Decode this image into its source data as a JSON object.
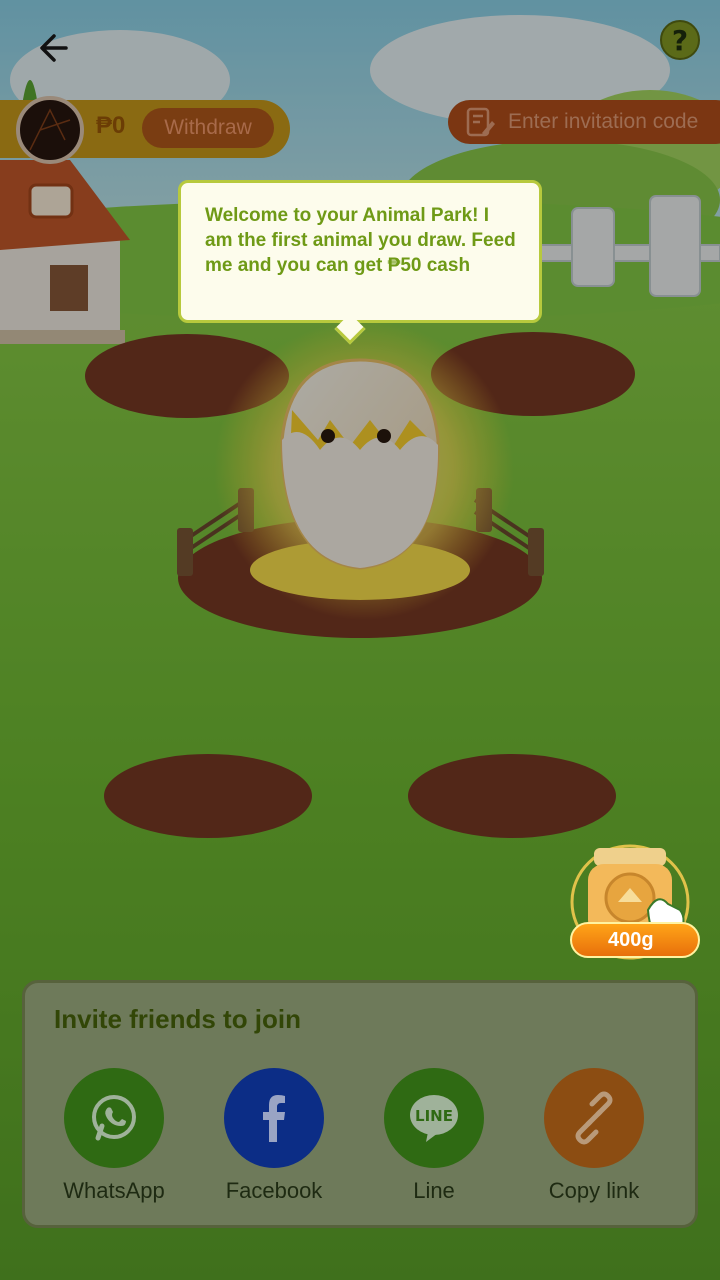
{
  "header": {
    "balance": "₱0",
    "withdraw_label": "Withdraw",
    "invite_code_label": "Enter invitation code",
    "help_symbol": "?"
  },
  "bubble": {
    "text": "Welcome to your Animal Park! I am the first animal you draw. Feed me and you can get ₱50 cash"
  },
  "feed": {
    "amount": "400g"
  },
  "invite": {
    "title": "Invite friends to join",
    "options": [
      {
        "label": "WhatsApp",
        "icon": "whatsapp-icon",
        "color": "#2f6a13"
      },
      {
        "label": "Facebook",
        "icon": "facebook-icon",
        "color": "#0c2d86"
      },
      {
        "label": "Line",
        "icon": "line-icon",
        "color": "#2f6a13"
      },
      {
        "label": "Copy link",
        "icon": "link-icon",
        "color": "#8c4d12"
      }
    ]
  }
}
